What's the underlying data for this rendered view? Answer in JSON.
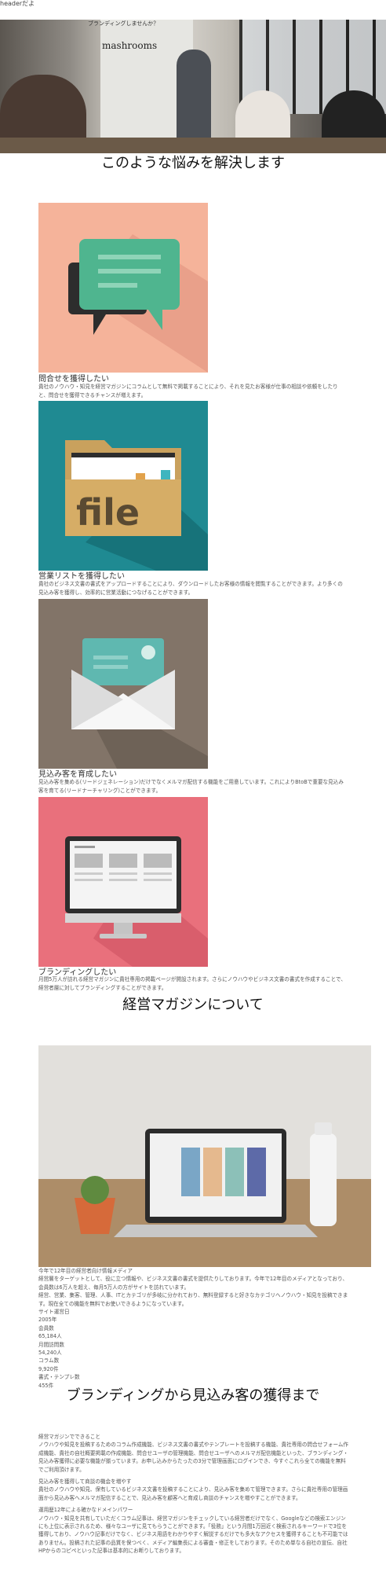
{
  "header": {
    "text": "headerだよ"
  },
  "hero": {
    "question": "ブランディングしませんか？",
    "brand": "mashrooms"
  },
  "section1": {
    "title": "このような悩みを解決します"
  },
  "cards": [
    {
      "title": "問合せを獲得したい",
      "desc": "貴社のノウハウ・知見を経営マガジンにコラムとして無料で掲載することにより、それを見たお客様が仕事の相談や依頼をしたりと、問合せを獲得できるチャンスが増えます。",
      "bg": "#f5b39a",
      "icon": "chat-bubbles-icon"
    },
    {
      "title": "営業リストを獲得したい",
      "desc": "貴社のビジネス文書の書式をアップロードすることにより、ダウンロードしたお客様の情報を閲覧することができます。より多くの見込み客を獲得し、効率的に営業活動につなげることができます。",
      "bg": "#1f8a92",
      "icon": "file-folder-icon",
      "icon_text": "file"
    },
    {
      "title": "見込み客を育成したい",
      "desc": "見込み客を集める(リードジェネレーション)だけでなくメルマガ配信する機能をご用意しています。これによりBtoBで重要な見込み客を育てる(リードナーチャリング)ことができます。",
      "bg": "#827468",
      "icon": "envelope-icon"
    },
    {
      "title": "ブランディングしたい",
      "desc": "月間5万人が訪れる経営マガジンに貴社専用の掲載ページが開設されます。さらにノウハウやビジネス文書の書式を作成することで、経営者層に対してブランディングすることができます。",
      "bg": "#e9707c",
      "icon": "monitor-icon"
    }
  ],
  "section2": {
    "title": "経営マガジンについて"
  },
  "magazine": {
    "intro": "今年で12年目の経営者向け情報メディア",
    "body": "経営層をターゲットとして、役に立つ情報や、ビジネス文書の書式を提供たりしております。今年で12年目のメディアとなっており、会員数は6万人を超え、毎月5万人の方がサイトを訪れています。",
    "body2": "経営、営業、集客、管理、人事、ITとカテゴリが多岐に分かれており、無料登録すると好きなカテゴリへノウハウ・知見を投稿できます。現在全ての機能を無料でお使いできるようになっています。",
    "stats": [
      {
        "label": "サイト運営日",
        "value": "2005年"
      },
      {
        "label": "会員数",
        "value": "65,184人"
      },
      {
        "label": "月間訪問数",
        "value": "54,240人"
      },
      {
        "label": "コラム数",
        "value": "9,920件"
      },
      {
        "label": "書式・テンプレ数",
        "value": "455件"
      }
    ]
  },
  "section3": {
    "title": "ブランディングから見込み客の獲得まで"
  },
  "features": [
    {
      "title": "経営マガジンでできること",
      "desc": "ノウハウや知見を投稿するためのコラム作成機能、ビジネス文書の書式やテンプレートを投稿する機能、貴社専用の問合せフォーム作成機能、貴社の自社概要掲載の作成機能、問合せユーザの管理機能、問合せユーザへのメルマガ配信機能といった、ブランディング・見込み客獲得に必要な機能が揃っています。お申し込みからたったの3分で管理画面にログインでき、今すぐこれら全ての機能を無料でご利用頂けます。"
    },
    {
      "title": "見込み客を獲得して商談の機会を増やす",
      "desc": "貴社のノウハウや知見、保有しているビジネス文書を投稿することにより、見込み客を集めて管理できます。さらに貴社専用の管理画面から見込み客へメルマガ配信することで、見込み客を顧客へと育成し商談のチャンスを増やすことができます。"
    },
    {
      "title": "運用歴12年による確かなドメインパワー",
      "desc": "ノウハウ・知見を共有していただくコラム記事は、経営マガジンをチェックしている経営者だけでなく、Googleなどの検索エンジンにも上位に表示されるため、様々なユーザに見てもらうことができます。「役務」という月間1万回近く検索されるキーワードで3位を獲得しており、ノウハウ記事だけでなく、ビジネス用語をわかりやすく解説するだけでも多大なアクセスを獲得することも不可能ではありません。投稿された記事の品質を保つべく、メディア編集長による審査・修正をしております。そのため単なる自社の宣伝、自社HPからのコピペといった記事は基本的にお断りしております。"
    }
  ]
}
